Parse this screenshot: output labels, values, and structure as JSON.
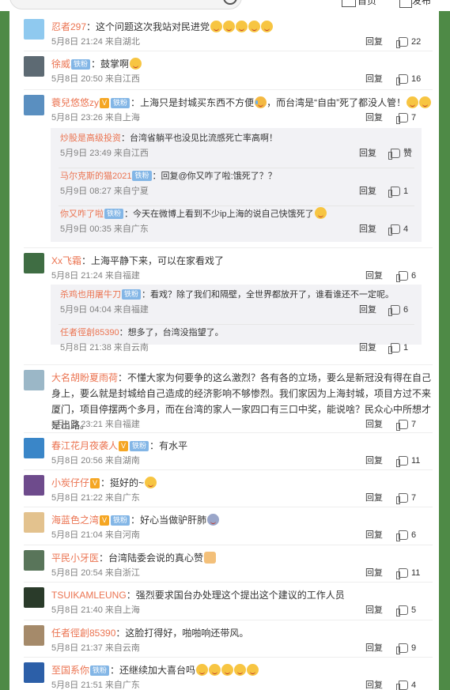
{
  "header": {
    "home_label": "首页",
    "tools_label": "发布"
  },
  "actions": {
    "reply": "回复",
    "like_placeholder": "赞"
  },
  "comments": [
    {
      "user": "忍者297",
      "badge": "",
      "vip": "",
      "text": "这个问题这次我站对民进党",
      "emojis": [
        "laugh",
        "laugh",
        "laugh",
        "laugh",
        "laugh"
      ],
      "meta": "5月8日 21:24 来自湖北",
      "likes": "22"
    },
    {
      "user": "徐威",
      "badge": "铁粉",
      "vip": "",
      "text": "鼓掌啊",
      "emojis": [
        "laugh"
      ],
      "meta": "5月8日 20:50 来自江西",
      "likes": "16"
    },
    {
      "user": "蓑兒悠悠zy",
      "badge": "铁粉",
      "vip": "V",
      "text": "上海只是封城买东西不方便",
      "mid_emoji": "tear",
      "text2": "，而台湾是“自由”死了都没人管！",
      "emojis": [
        "laugh",
        "laugh"
      ],
      "meta": "5月8日 23:26 来自上海",
      "likes": "7",
      "replies": [
        {
          "user": "炒股是高级投资",
          "badge": "",
          "text": "台湾省躺平也没见比流感死亡率高啊！",
          "meta": "5月9日 23:49 来自江西",
          "likes": "赞"
        },
        {
          "user": "马尔克斯的猫2021",
          "badge": "铁粉",
          "text": "回复@你又咋了啦:饿死了？？",
          "meta": "5月9日 08:27 来自宁夏",
          "likes": "1"
        },
        {
          "user": "你又咋了啦",
          "badge": "铁粉",
          "text": "今天在微博上看到不少ip上海的说自己快饿死了",
          "emojis": [
            "laugh"
          ],
          "meta": "5月9日 00:35 来自广东",
          "likes": "4"
        }
      ]
    },
    {
      "user": "Xx飞霜",
      "badge": "",
      "vip": "",
      "text": "上海平静下来，可以在家看戏了",
      "meta": "5月8日 21:24 来自福建",
      "likes": "6",
      "replies": [
        {
          "user": "杀鸡也用屠牛刀",
          "badge": "铁粉",
          "text": "看戏？除了我们和隔壁，全世界都放开了，谁看谁还不一定呢。",
          "meta": "5月9日 04:04 来自福建",
          "likes": "6"
        },
        {
          "user": "任者徑創85390",
          "badge": "",
          "text": "想多了，台湾没指望了。",
          "meta": "5月8日 21:38 来自云南",
          "likes": "1"
        }
      ]
    },
    {
      "user": "大名胡盼夏雨荷",
      "badge": "",
      "vip": "",
      "text": "不懂大家为何要争的这么激烈？各有各的立场，要么是新冠没有得在自己身上，要么就是封城给自己造成的经济影响不够惨烈。我们家因为上海封城，项目方过不来厦门，项目停摆两个多月，而在台湾的家人一家四口有三口中奖，能说啥？民众心中所想才是出路。",
      "meta": "5月8日 23:21 来自福建",
      "likes": "7"
    },
    {
      "user": "春江花月夜袭人",
      "badge": "铁粉",
      "vip": "V",
      "text": "有水平",
      "meta": "5月8日 20:56 来自湖南",
      "likes": "11"
    },
    {
      "user": "小炭仔仔",
      "badge": "",
      "vip": "V",
      "text": "挺好的~",
      "emojis": [
        "laugh"
      ],
      "meta": "5月8日 21:22 来自广东",
      "likes": "7"
    },
    {
      "user": "海蓝色之湾",
      "badge": "铁粉",
      "vip": "V",
      "text": "好心当做驴肝肺",
      "emojis": [
        "scared"
      ],
      "meta": "5月8日 21:04 来自河南",
      "likes": "6"
    },
    {
      "user": "平民小牙医",
      "badge": "",
      "vip": "",
      "text": "台湾陆委会说的真心赞",
      "emojis": [
        "thumb"
      ],
      "meta": "5月8日 20:54 来自浙江",
      "likes": "11"
    },
    {
      "user": "TSUIKAMLEUNG",
      "badge": "",
      "vip": "",
      "text": "强烈要求国台办处理这个提出这个建议的工作人员",
      "meta": "5月8日 21:40 来自上海",
      "likes": "5"
    },
    {
      "user": "任者徑創85390",
      "badge": "",
      "vip": "",
      "text": "这脸打得好，啪啪响还带风。",
      "meta": "5月8日 21:37 来自云南",
      "likes": "9"
    },
    {
      "user": "至国系你",
      "badge": "铁粉",
      "vip": "",
      "text": "还继续加大喜台吗",
      "emojis": [
        "laugh",
        "laugh",
        "laugh",
        "laugh",
        "laugh"
      ],
      "meta": "5月8日 21:51 来自广东",
      "likes": "4"
    }
  ],
  "colors": {
    "username": "#eb7350",
    "fan_badge": "#83b6e6",
    "vip_badge": "#f5a623",
    "side": "#4e8a46"
  }
}
